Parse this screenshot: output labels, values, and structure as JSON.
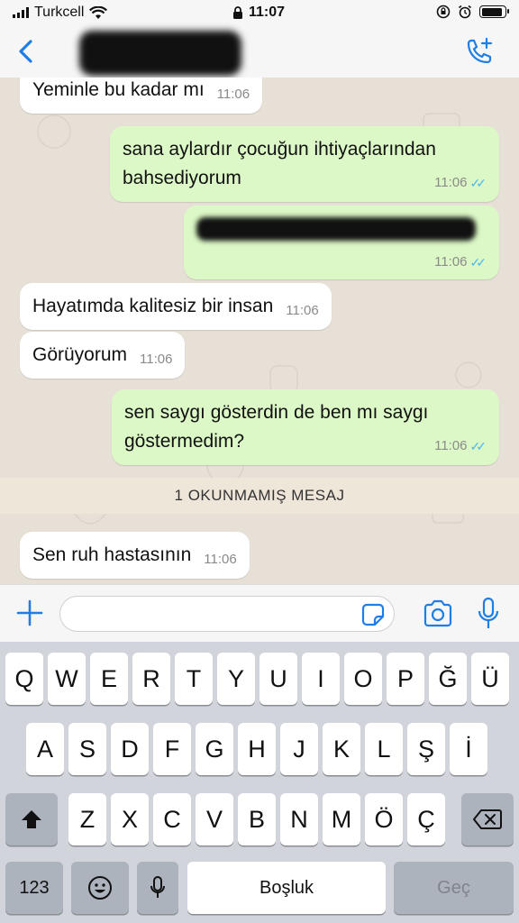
{
  "status_bar": {
    "carrier": "Turkcell",
    "time": "11:07",
    "battery_level": 0.9
  },
  "header": {
    "contact_name": "contact",
    "back_icon": "chevron-left-icon",
    "call_icon": "add-call-icon"
  },
  "messages": [
    {
      "direction": "in",
      "text": "Yeminle bu kadar mı",
      "time": "11:06"
    },
    {
      "direction": "out",
      "text": "sana aylardır çocuğun ihtiyaçlarından bahsediyorum",
      "time": "11:06",
      "read": true
    },
    {
      "direction": "out",
      "text": "",
      "redacted": true,
      "time": "11:06",
      "read": true
    },
    {
      "direction": "in",
      "text": "Hayatımda kalitesiz bir insan",
      "time": "11:06"
    },
    {
      "direction": "in",
      "text": "Görüyorum",
      "time": "11:06"
    },
    {
      "direction": "out",
      "text": "sen saygı gösterdin de ben mı saygı göstermedim?",
      "time": "11:06",
      "read": true
    }
  ],
  "unread_banner": "1 OKUNMAMIŞ MESAJ",
  "unread_messages": [
    {
      "direction": "in",
      "text": "Sen ruh hastasının",
      "time": "11:06"
    }
  ],
  "input_bar": {
    "placeholder": "",
    "icons": [
      "plus-icon",
      "sticker-icon",
      "camera-icon",
      "microphone-icon"
    ]
  },
  "keyboard": {
    "row1": [
      "Q",
      "W",
      "E",
      "R",
      "T",
      "Y",
      "U",
      "I",
      "O",
      "P",
      "Ğ",
      "Ü"
    ],
    "row2": [
      "A",
      "S",
      "D",
      "F",
      "G",
      "H",
      "J",
      "K",
      "L",
      "Ş",
      "İ"
    ],
    "row3": [
      "Z",
      "X",
      "C",
      "V",
      "B",
      "N",
      "M",
      "Ö",
      "Ç"
    ],
    "numbers_key": "123",
    "space_key": "Boşluk",
    "return_key": "Geç"
  },
  "colors": {
    "accent": "#1e7ee6",
    "outgoing_bubble": "#dcf8c6",
    "incoming_bubble": "#ffffff",
    "chat_background": "#e7e0d7",
    "read_ticks": "#4fb6ec"
  }
}
